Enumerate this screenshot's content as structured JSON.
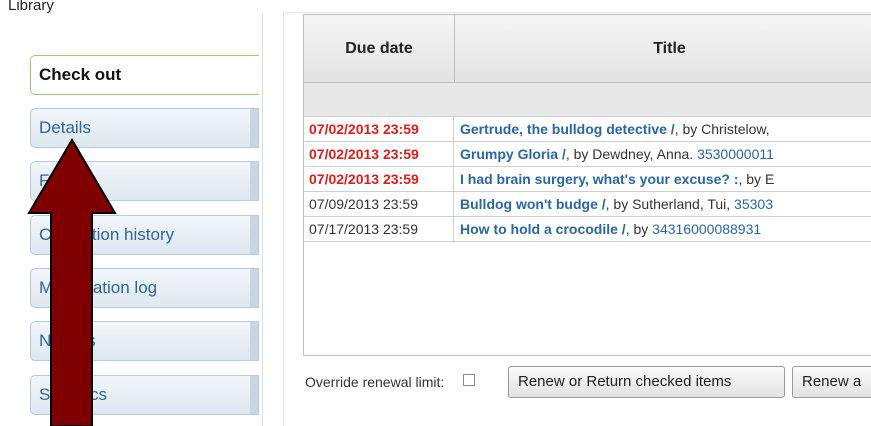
{
  "library_label": "Library",
  "sidebar": {
    "items": [
      {
        "label": "Check out",
        "active": true
      },
      {
        "label": "Details",
        "active": false
      },
      {
        "label": "Fines",
        "active": false
      },
      {
        "label": "Circulation history",
        "active": false
      },
      {
        "label": "Modification log",
        "active": false
      },
      {
        "label": "Notices",
        "active": false
      },
      {
        "label": "Statistics",
        "active": false
      }
    ]
  },
  "table": {
    "headers": {
      "due_date": "Due date",
      "title": "Title"
    },
    "rows": [
      {
        "due": "07/02/2013 23:59",
        "overdue": true,
        "title": "Gertrude, the bulldog detective /",
        "rest": ", by Christelow,",
        "barcode": ""
      },
      {
        "due": "07/02/2013 23:59",
        "overdue": true,
        "title": "Grumpy Gloria /",
        "rest": ", by Dewdney, Anna. ",
        "barcode": "3530000011"
      },
      {
        "due": "07/02/2013 23:59",
        "overdue": true,
        "title": "I had brain surgery, what's your excuse? :",
        "rest": ", by E",
        "barcode": ""
      },
      {
        "due": "07/09/2013 23:59",
        "overdue": false,
        "title": "Bulldog won't budge /",
        "rest": ", by Sutherland, Tui, ",
        "barcode": "35303"
      },
      {
        "due": "07/17/2013 23:59",
        "overdue": false,
        "title": "How to hold a crocodile /",
        "rest": ", by ",
        "barcode": "34316000088931"
      }
    ]
  },
  "controls": {
    "override_label": "Override renewal limit:",
    "renew_return_label": "Renew or Return checked items",
    "renew_all_label": "Renew a"
  },
  "colors": {
    "overdue": "#e01b1b",
    "link": "#2a66a6",
    "arrow_fill": "#7f0000",
    "arrow_outline": "#000000"
  }
}
